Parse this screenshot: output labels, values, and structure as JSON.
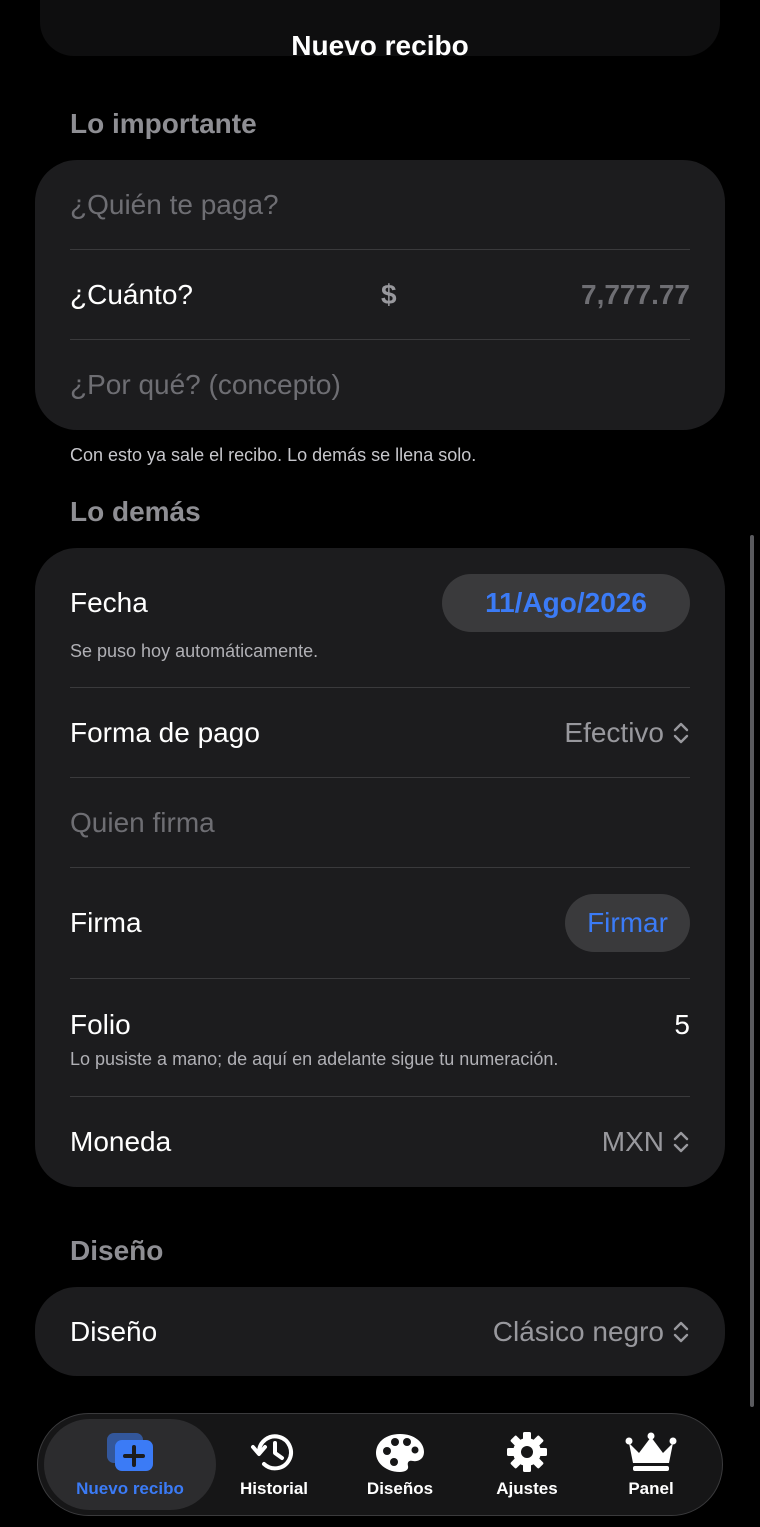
{
  "nav": {
    "title": "Nuevo recibo"
  },
  "section_important": {
    "header": "Lo importante",
    "payer_placeholder": "¿Quién te paga?",
    "amount_label": "¿Cuánto?",
    "currency_symbol": "$",
    "amount_placeholder": "7,777.77",
    "concept_placeholder": "¿Por qué? (concepto)",
    "footnote": "Con esto ya sale el recibo. Lo demás se llena solo."
  },
  "section_other": {
    "header": "Lo demás",
    "date_label": "Fecha",
    "date_value": "11/Ago/2026",
    "date_note": "Se puso hoy automáticamente.",
    "payment_label": "Forma de pago",
    "payment_value": "Efectivo",
    "signer_placeholder": "Quien firma",
    "signature_label": "Firma",
    "signature_button": "Firmar",
    "folio_label": "Folio",
    "folio_value": "5",
    "folio_note": "Lo pusiste a mano; de aquí en adelante sigue tu numeración.",
    "currency_label": "Moneda",
    "currency_value": "MXN"
  },
  "section_design": {
    "header": "Diseño",
    "design_label": "Diseño",
    "design_value": "Clásico negro"
  },
  "tabbar": {
    "tabs": [
      {
        "label": "Nuevo recibo",
        "icon": "new-receipt-icon",
        "active": true
      },
      {
        "label": "Historial",
        "icon": "history-icon",
        "active": false
      },
      {
        "label": "Diseños",
        "icon": "palette-icon",
        "active": false
      },
      {
        "label": "Ajustes",
        "icon": "gear-icon",
        "active": false
      },
      {
        "label": "Panel",
        "icon": "crown-icon",
        "active": false
      }
    ]
  },
  "colors": {
    "accent": "#3b7bf6",
    "card": "#1c1c1e",
    "background": "#000000"
  }
}
